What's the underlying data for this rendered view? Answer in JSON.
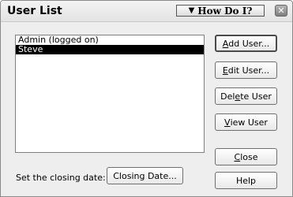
{
  "window": {
    "title": "User List",
    "how_do_i": "How Do I?",
    "close_glyph": "✕"
  },
  "users": [
    {
      "name": "Admin (logged on)",
      "selected": false
    },
    {
      "name": "Steve",
      "selected": true
    }
  ],
  "buttons": {
    "add_user": {
      "accel": "A",
      "rest": "dd User..."
    },
    "edit_user": {
      "accel": "E",
      "rest": "dit User..."
    },
    "delete_user": {
      "pre": "Del",
      "accel": "e",
      "rest": "te User"
    },
    "view_user": {
      "accel": "V",
      "rest": "iew User"
    },
    "close": {
      "accel": "C",
      "rest": "lose"
    },
    "help": {
      "label": "Help"
    }
  },
  "closing_date": {
    "label": "Set the closing date:",
    "button": "Closing Date..."
  },
  "colors": {
    "selection_bg": "#000000",
    "selection_fg": "#ffffff"
  }
}
